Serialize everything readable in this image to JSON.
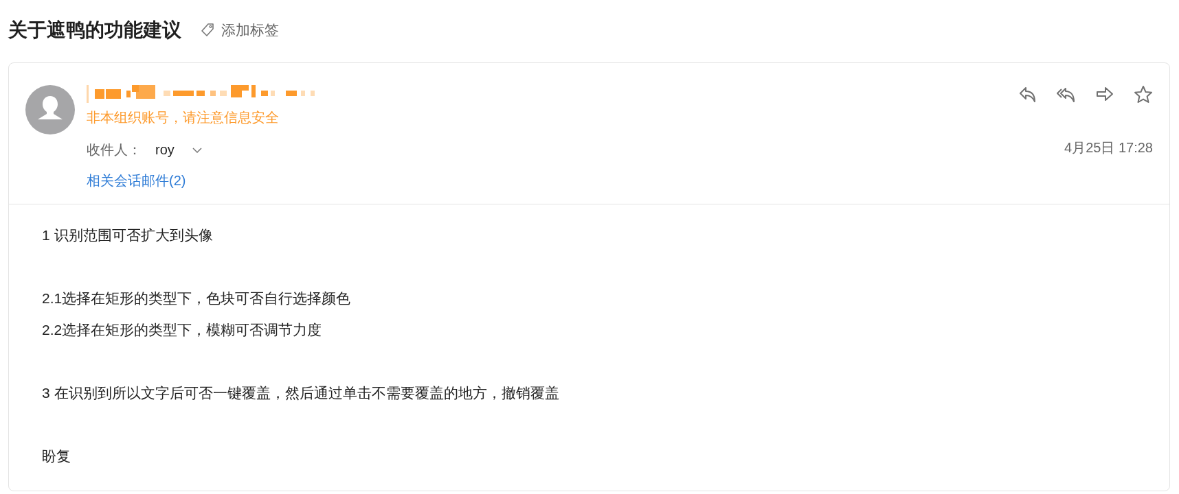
{
  "subject": "关于遮鸭的功能建议",
  "add_tag": "添加标签",
  "sender": {
    "warning": "非本组织账号，请注意信息安全"
  },
  "recipients": {
    "label": "收件人：",
    "name": "roy"
  },
  "related": "相关会话邮件(2)",
  "date": "4月25日 17:28",
  "body": [
    [
      "1 识别范围可否扩大到头像"
    ],
    [
      "2.1选择在矩形的类型下，色块可否自行选择颜色",
      "2.2选择在矩形的类型下，模糊可否调节力度"
    ],
    [
      "3 在识别到所以文字后可否一键覆盖，然后通过单击不需要覆盖的地方，撤销覆盖"
    ],
    [
      "盼复"
    ]
  ]
}
